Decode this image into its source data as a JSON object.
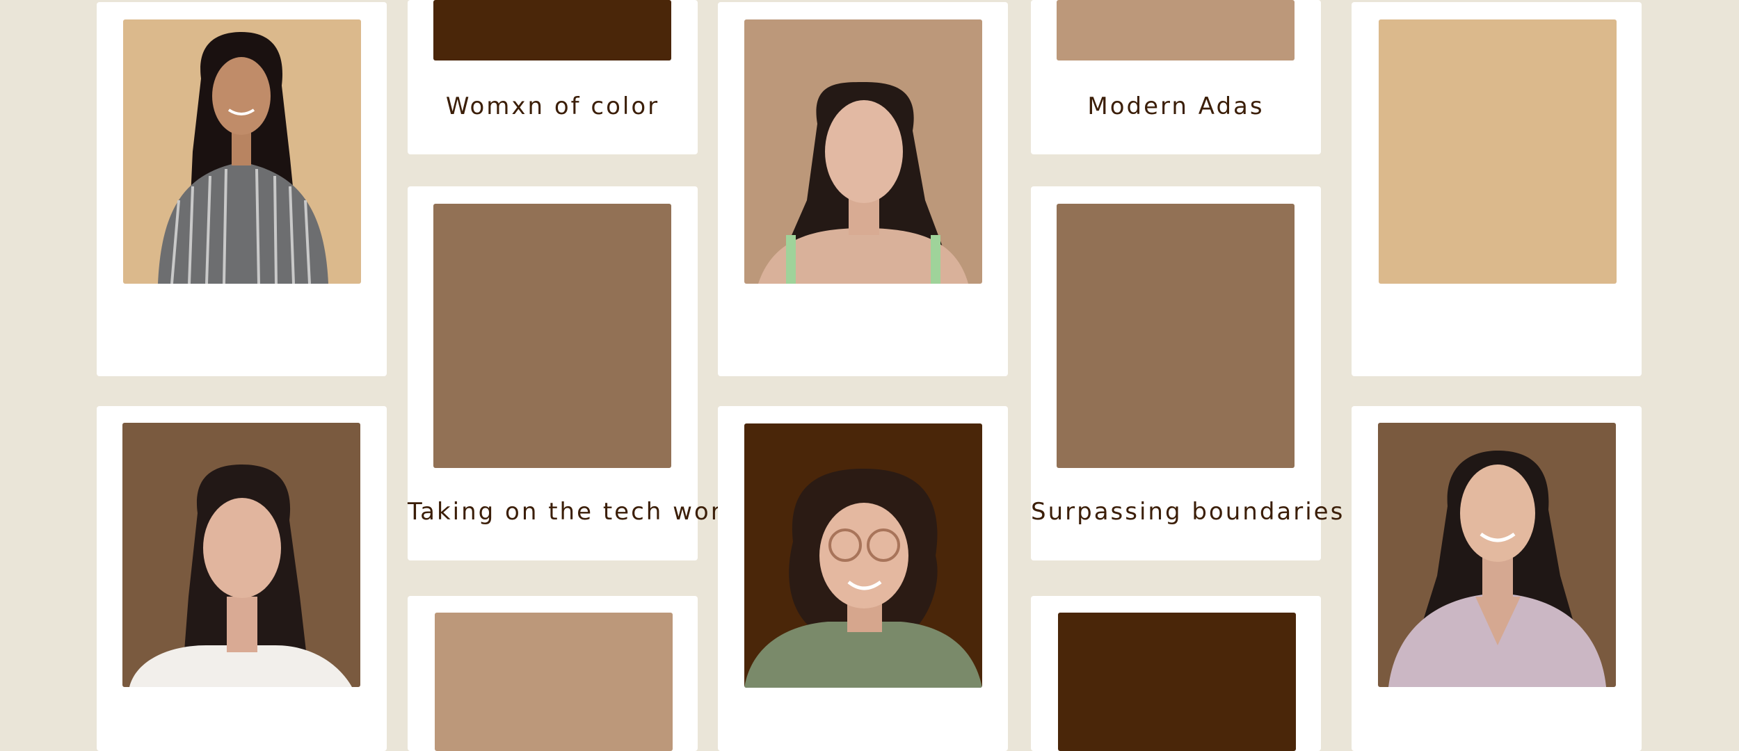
{
  "palette": {
    "background": "#eae5d8",
    "card": "#ffffff",
    "swatch_dark": "#4a2609",
    "swatch_medium": "#927155",
    "swatch_light": "#bc987a",
    "swatch_sand": "#dbb98c",
    "text": "#3b1e08"
  },
  "captions": {
    "c1": "Womxn of color",
    "c2": "Modern Adas",
    "c3": "Taking on the tech world",
    "c4": "Surpassing boundaries"
  },
  "portraits": [
    {
      "name": "portrait-woman-striped-shirt",
      "bg": "#dbb98c"
    },
    {
      "name": "portrait-woman-long-dark-hair",
      "bg": "#bc987a"
    },
    {
      "name": "portrait-woman-white-top",
      "bg": "#7a5a3f"
    },
    {
      "name": "portrait-person-glasses-curly-hair",
      "bg": "#4a2609"
    },
    {
      "name": "portrait-woman-lilac-blouse",
      "bg": "#7a5a3f"
    }
  ]
}
